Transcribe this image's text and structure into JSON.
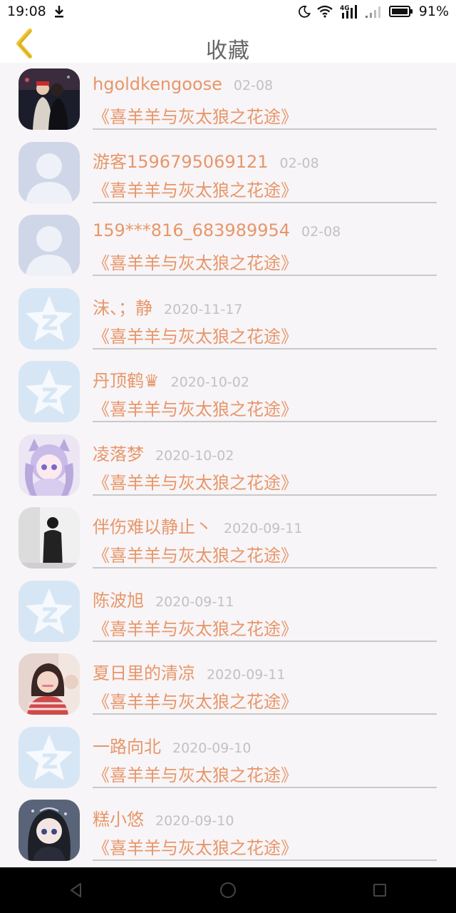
{
  "status_bar": {
    "time": "19:08",
    "battery": "91%",
    "network": "4G"
  },
  "header": {
    "title": "收藏",
    "back_icon": "chevron-left-icon"
  },
  "colors": {
    "accent": "#e8966a",
    "back_icon": "#f0c330",
    "date": "#c2c2c2",
    "title": "#666666"
  },
  "items": [
    {
      "username": "hgoldkengoose",
      "date": "02-08",
      "title": "《喜羊羊与灰太狼之花途》",
      "avatar": "photo-couple"
    },
    {
      "username": "游客1596795069121",
      "date": "02-08",
      "title": "《喜羊羊与灰太狼之花途》",
      "avatar": "default-person"
    },
    {
      "username": "159***816_683989954",
      "date": "02-08",
      "title": "《喜羊羊与灰太狼之花途》",
      "avatar": "default-person"
    },
    {
      "username": "沫、；静",
      "date": "2020-11-17",
      "title": "《喜羊羊与灰太狼之花途》",
      "avatar": "qzone-star"
    },
    {
      "username": "丹顶鹤♛",
      "date": "2020-10-02",
      "title": "《喜羊羊与灰太狼之花途》",
      "avatar": "qzone-star"
    },
    {
      "username": "凌落梦",
      "date": "2020-10-02",
      "title": "《喜羊羊与灰太狼之花途》",
      "avatar": "anime-girl-purple"
    },
    {
      "username": "伴伤难以静止丶",
      "date": "2020-09-11",
      "title": "《喜羊羊与灰太狼之花途》",
      "avatar": "photo-bw"
    },
    {
      "username": "陈波旭",
      "date": "2020-09-11",
      "title": "《喜羊羊与灰太狼之花途》",
      "avatar": "qzone-star"
    },
    {
      "username": "夏日里的清凉",
      "date": "2020-09-11",
      "title": "《喜羊羊与灰太狼之花途》",
      "avatar": "photo-girl"
    },
    {
      "username": "一路向北",
      "date": "2020-09-10",
      "title": "《喜羊羊与灰太狼之花途》",
      "avatar": "qzone-star"
    },
    {
      "username": "糕小悠",
      "date": "2020-09-10",
      "title": "《喜羊羊与灰太狼之花途》",
      "avatar": "anime-girl-dark"
    }
  ],
  "nav": [
    "back-triangle-icon",
    "home-circle-icon",
    "recents-square-icon"
  ]
}
